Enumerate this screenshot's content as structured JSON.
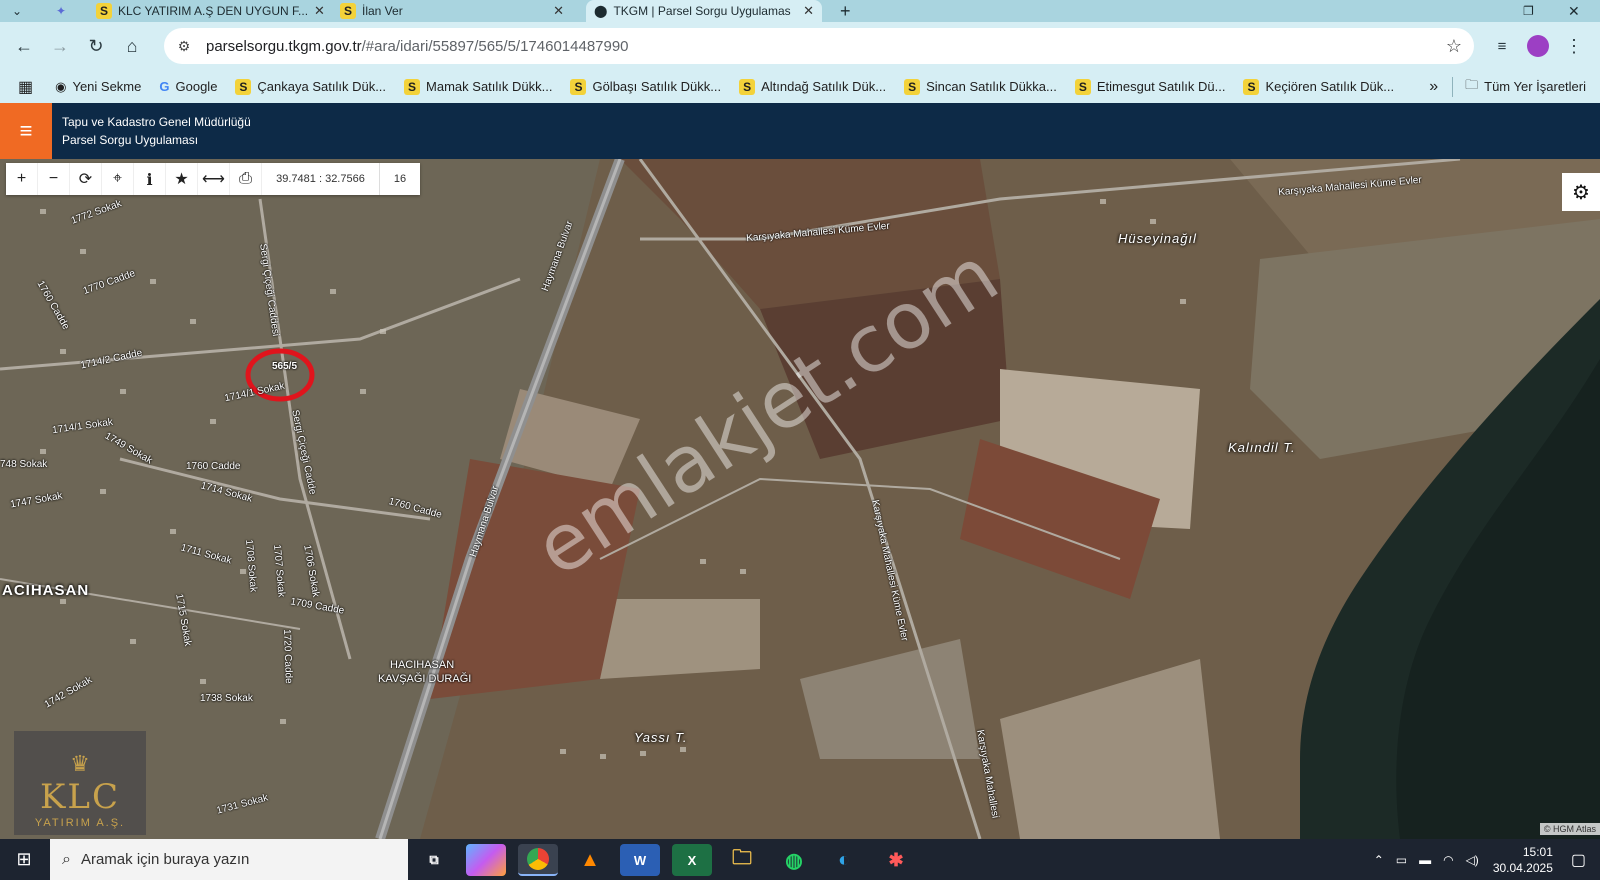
{
  "browser": {
    "tabs": [
      {
        "label": "KLC YATIRIM A.Ş DEN UYGUN F...",
        "favicon": "S",
        "active": false
      },
      {
        "label": "İlan Ver",
        "favicon": "S",
        "active": false
      },
      {
        "label": "TKGM | Parsel Sorgu Uygulamas",
        "favicon": "location-pin",
        "active": true
      }
    ],
    "new_tab_symbol": "+",
    "url_host": "parselsorgu.tkgm.gov.tr",
    "url_path": "/#ara/idari/55897/565/5/1746014487990",
    "bookmarks": [
      {
        "label": "Yeni Sekme",
        "icon": "globe-icon"
      },
      {
        "label": "Google",
        "icon": "google-icon"
      },
      {
        "label": "Çankaya Satılık Dük...",
        "icon": "S"
      },
      {
        "label": "Mamak Satılık Dükk...",
        "icon": "S"
      },
      {
        "label": "Gölbaşı Satılık Dükk...",
        "icon": "S"
      },
      {
        "label": "Altındağ Satılık Dük...",
        "icon": "S"
      },
      {
        "label": "Sincan Satılık Dükka...",
        "icon": "S"
      },
      {
        "label": "Etimesgut Satılık Dü...",
        "icon": "S"
      },
      {
        "label": "Keçiören Satılık Dük...",
        "icon": "S"
      }
    ],
    "bookmarks_more": "»",
    "all_bookmarks": "Tüm Yer İşaretleri"
  },
  "app": {
    "title_line1": "Tapu ve Kadastro Genel Müdürlüğü",
    "title_line2": "Parsel Sorgu Uygulaması",
    "accent_color": "#f06a23",
    "header_color": "#0d2a47"
  },
  "map": {
    "coordinates": "39.7481 : 32.7566",
    "zoom_level": "16",
    "attribution": "© HGM Atlas",
    "parcel_label": "565/5",
    "place_labels": [
      "Hüseyinağıl",
      "Kalındil T.",
      "Yassı T.",
      "ACIHASAN"
    ],
    "road_labels": [
      "Karşıyaka Mahallesi Küme Evler",
      "Karşıyaka Mahallesi Küme Evler",
      "Haymana Bulvar",
      "Haymana Bulvar",
      "Karşıyaka Mahallesi Küme Evler",
      "Karşıyaka Mahallesi",
      "1760 Cadde",
      "1760 Cadde",
      "1760 Cadde",
      "1772 Sokak",
      "1770 Cadde",
      "1714/2 Cadde",
      "1714/1 Sokak",
      "1714/1 Sokak",
      "1749 Sokak",
      "1747 Sokak",
      "1714 Sokak",
      "1711 Sokak",
      "1709 Cadde",
      "1708 Sokak",
      "1707 Sokak",
      "1706 Sokak",
      "1720 Cadde",
      "1715 Sokak",
      "1742 Sokak",
      "1738 Sokak",
      "1731 Sokak",
      "748 Sokak",
      "Sergi Çiçeği Caddesi",
      "Sergi Çiçeği Cadde",
      "HACIHASAN",
      "KAVŞAĞI DURAĞI"
    ],
    "watermark": "emlakjet.com",
    "logo_text": "KLC",
    "logo_subtext": "YATIRIM A.Ş."
  },
  "taskbar": {
    "search_placeholder": "Aramak için buraya yazın",
    "time": "15:01",
    "date": "30.04.2025"
  }
}
